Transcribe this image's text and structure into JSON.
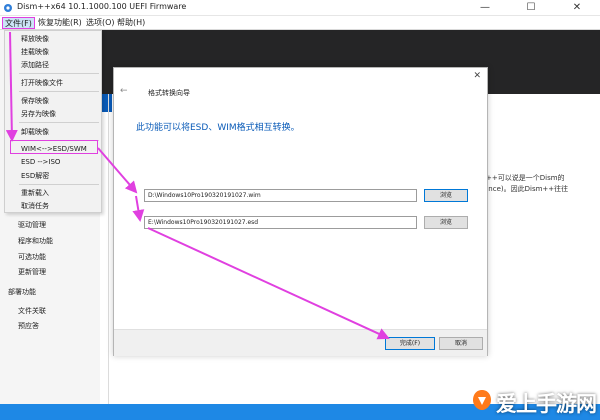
{
  "window": {
    "title": "Dism++x64 10.1.1000.100 UEFI Firmware",
    "min_glyph": "—",
    "max_glyph": "☐",
    "close_glyph": "✕"
  },
  "menubar": {
    "file": "文件(F)",
    "restore": "恢复功能(R)",
    "options": "选项(O)",
    "help": "帮助(H)"
  },
  "file_menu": {
    "items": [
      "释放映像",
      "挂载映像",
      "添加路径",
      "打开映像文件",
      "保存映像",
      "另存为映像",
      "卸载映像",
      "WIM<-->ESD/SWM",
      "ESD -->ISO",
      "ESD解密",
      "重新载入",
      "取消任务"
    ]
  },
  "sidebar": {
    "items": [
      "驱动管理",
      "程序和功能",
      "可选功能",
      "更新管理"
    ],
    "section": "部署功能",
    "section_items": [
      "文件关联",
      "预应答"
    ]
  },
  "main": {
    "line1": "++可以说是一个Dism的",
    "line2": "ence)。因此Dism++往往"
  },
  "dialog": {
    "back_glyph": "←",
    "close_glyph": "✕",
    "title": "格式转换向导",
    "heading": "此功能可以将ESD、WIM格式相互转换。",
    "source_path": "D:\\Windows10Pro190320191027.wim",
    "target_path": "E:\\Windows10Pro190320191027.esd",
    "browse_label": "浏览",
    "finish_label": "完成(F)",
    "cancel_label": "取消"
  },
  "watermark": {
    "text": "爱上手游网"
  },
  "colors": {
    "accent_blue": "#0a5bb8",
    "annotation_magenta": "#e040e0",
    "header_dark": "#252526",
    "bottom_strip": "#1e88e5"
  }
}
